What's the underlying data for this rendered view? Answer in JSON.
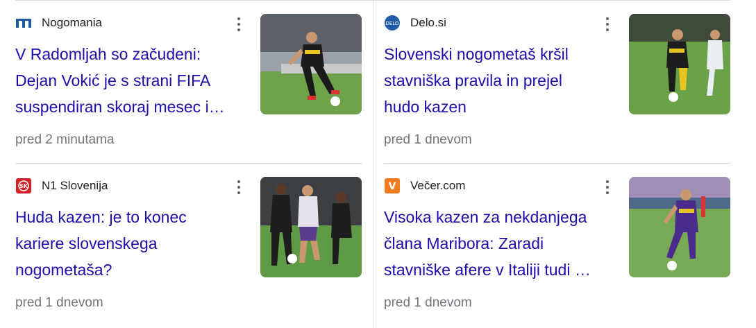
{
  "cards": [
    {
      "source": "Nogomania",
      "favicon": "nogomania-logo-icon",
      "headline_lines": [
        "V Radomljah so začudeni:",
        "Dejan Vokić je s strani FIFA",
        "suspendiran skoraj mesec i…"
      ],
      "time": "pred 2 minutama",
      "thumbnail": "football-player-photo"
    },
    {
      "source": "Delo.si",
      "favicon": "delo-logo-icon",
      "headline_lines": [
        "Slovenski nogometaš kršil",
        "stavniška pravila in prejel",
        "hudo kazen"
      ],
      "time": "pred 1 dnevom",
      "thumbnail": "football-players-photo"
    },
    {
      "source": "N1 Slovenija",
      "favicon": "sportklub-logo-icon",
      "headline_lines": [
        "Huda kazen: je to konec",
        "kariere slovenskega",
        "nogometaša?"
      ],
      "time": "pred 1 dnevom",
      "thumbnail": "football-match-photo"
    },
    {
      "source": "Večer.com",
      "favicon": "vecer-logo-icon",
      "headline_lines": [
        "Visoka kazen za nekdanjega",
        "člana Maribora: Zaradi",
        "stavniške afere v Italiji tudi …"
      ],
      "time": "pred 1 dnevom",
      "thumbnail": "maribor-player-photo"
    }
  ],
  "colors": {
    "headline": "#1a0dab",
    "meta": "#70757a",
    "divider": "#dadce0",
    "vecer_orange": "#f47c20",
    "sk_red": "#d32027",
    "delo_blue": "#1f5aa6"
  }
}
